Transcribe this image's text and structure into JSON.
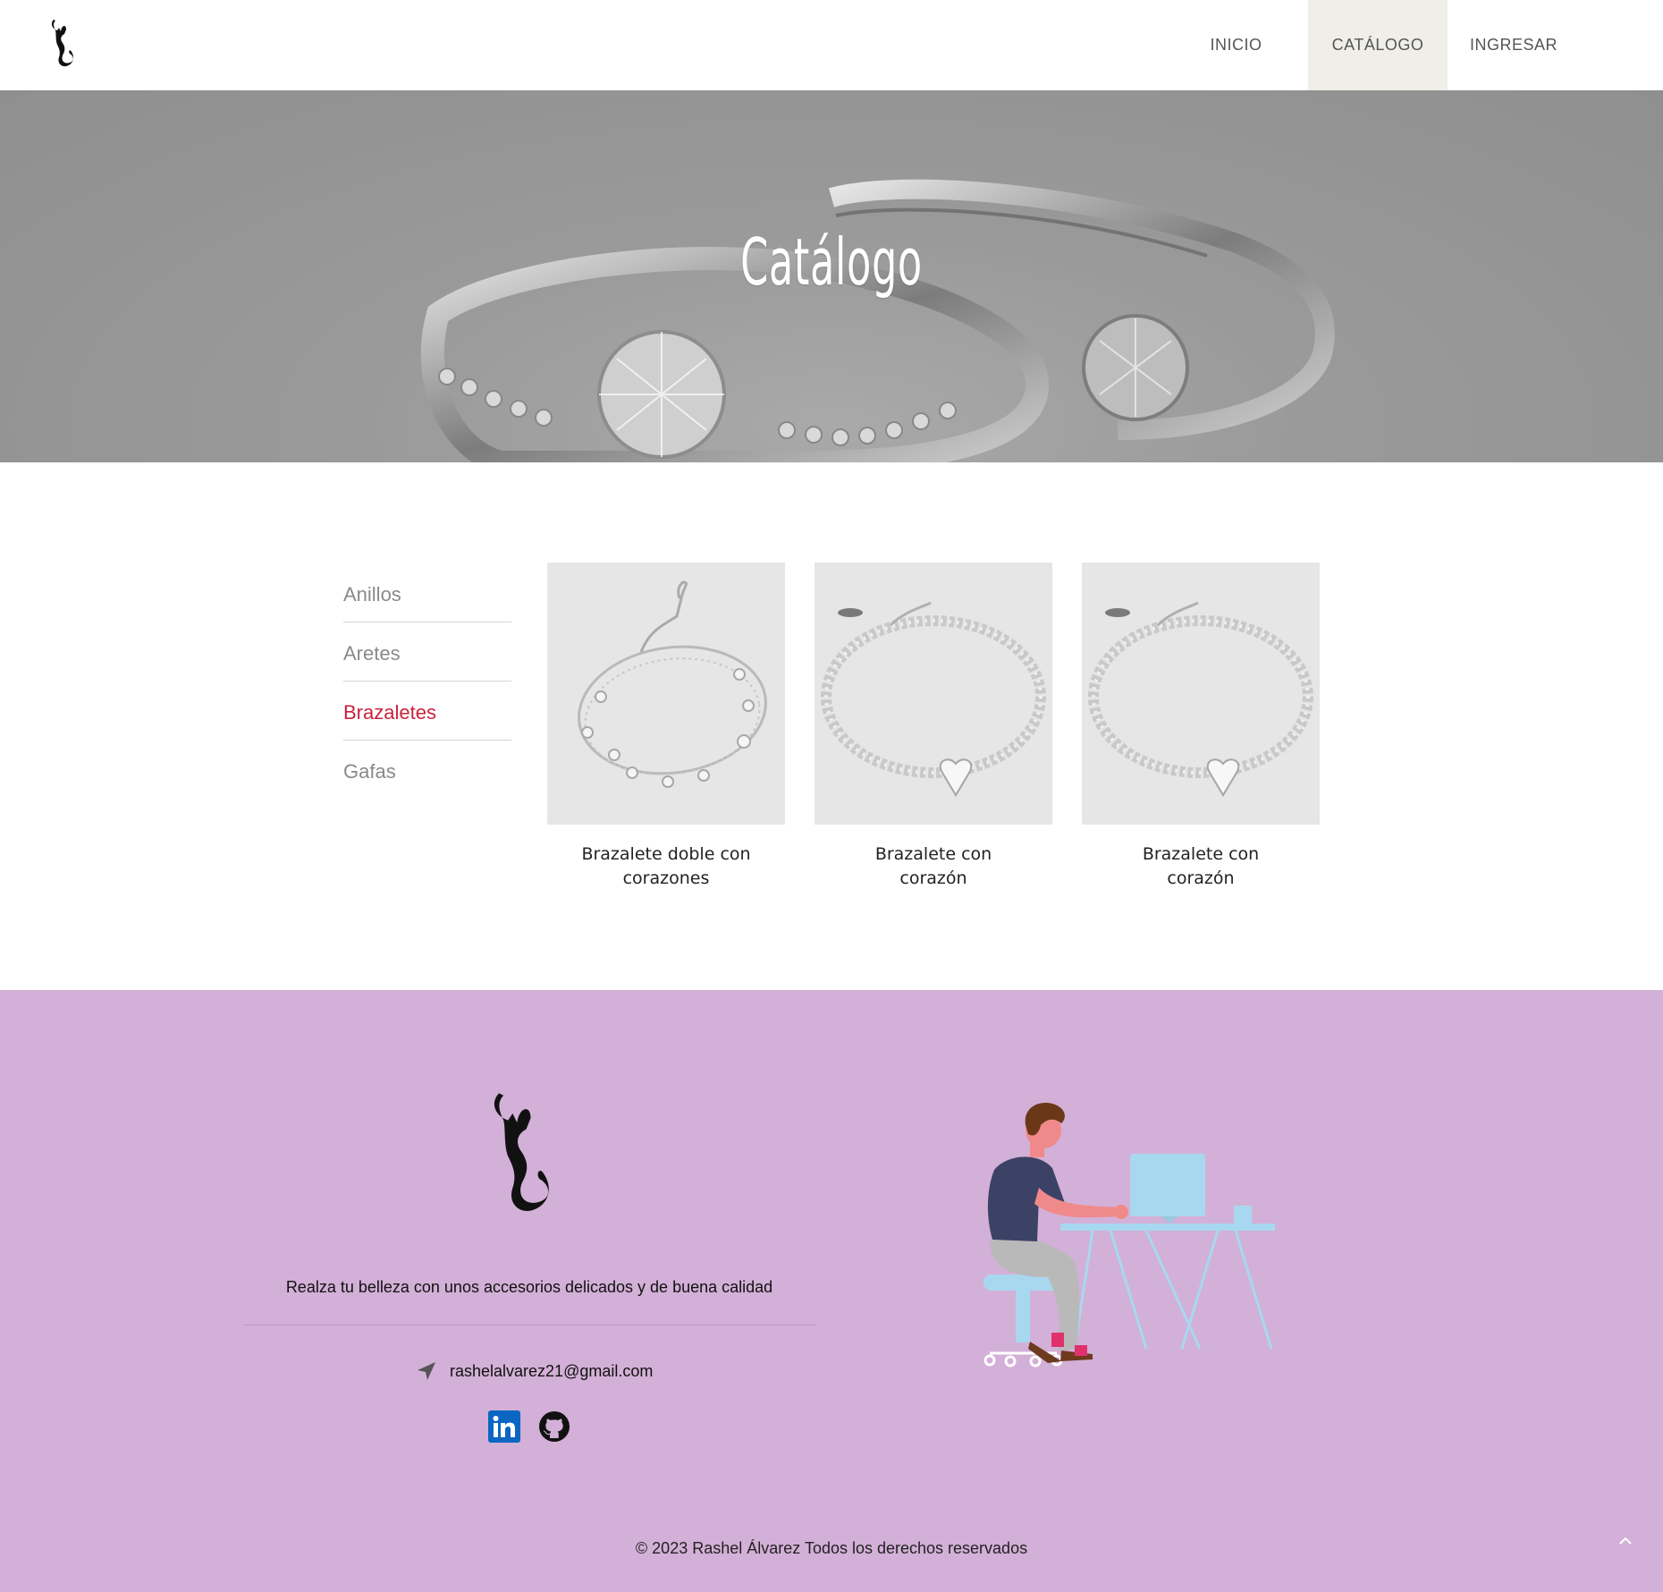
{
  "header": {
    "logo_icon": "cat-silhouette-logo",
    "nav": [
      {
        "label": "INICIO"
      },
      {
        "label": "CATÁLOGO",
        "active": true
      },
      {
        "label": "INGRESAR"
      }
    ],
    "active_bg": "#efeee9"
  },
  "hero": {
    "title": "Catálogo",
    "background_icon": "rings-photo"
  },
  "catalog": {
    "categories": [
      {
        "label": "Anillos"
      },
      {
        "label": "Aretes"
      },
      {
        "label": "Brazaletes",
        "active": true
      },
      {
        "label": "Gafas"
      }
    ],
    "active_color": "#c8233c",
    "products": [
      {
        "name": "Brazalete doble con corazones",
        "image_icon": "double-heart-bracelet"
      },
      {
        "name": "Brazalete con corazón",
        "image_icon": "bead-heart-bracelet"
      },
      {
        "name": "Brazalete con corazón",
        "image_icon": "bead-heart-bracelet"
      }
    ]
  },
  "footer": {
    "background": "#d3b0d7",
    "tagline": "Realza tu belleza con unos accesorios delicados y de buena calidad",
    "email": "rashelalvarez21@gmail.com",
    "email_icon": "location-arrow-icon",
    "social": [
      {
        "name": "linkedin-icon",
        "color": "#0a66c2"
      },
      {
        "name": "github-icon",
        "color": "#111111"
      }
    ],
    "illustration_icon": "person-at-desk-illustration",
    "copyright": "© 2023 Rashel Álvarez Todos los derechos reservados",
    "scroll_top_icon": "chevron-up-icon"
  }
}
